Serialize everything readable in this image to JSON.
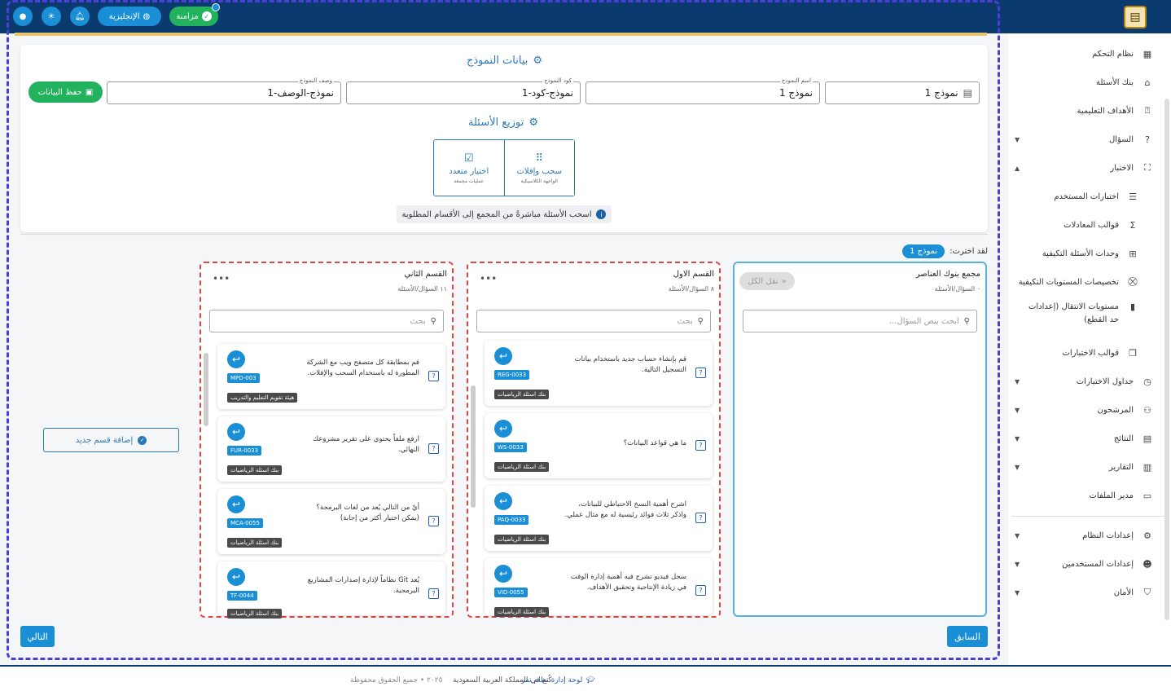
{
  "topbar": {
    "sync_label": "مزامنة",
    "language_label": "الإنجليزية",
    "colors": {
      "bar": "#0b3a6e",
      "sync": "#22b25d",
      "accent": "#1a8fd6"
    }
  },
  "sidebar": {
    "items": [
      {
        "label": "نظام التحكم",
        "icon": "dashboard-icon"
      },
      {
        "label": "بنك الأسئلة",
        "icon": "bank-icon"
      },
      {
        "label": "الأهداف التعليمية",
        "icon": "objectives-icon"
      },
      {
        "label": "السؤال",
        "icon": "question-icon"
      },
      {
        "label": "الاختبار",
        "icon": "exam-icon"
      },
      {
        "label": "اختبارات المستخدم",
        "icon": "list-icon"
      },
      {
        "label": "قوالب المعادلات",
        "icon": "sigma-icon"
      },
      {
        "label": "وحدات الأسئلة التكيفية",
        "icon": "grid-icon"
      },
      {
        "label": "تخصيصات المستويات التكيفية",
        "icon": "target-icon"
      },
      {
        "label": "مستويات الانتقال (إعدادات حد القطع)",
        "icon": "levels-icon"
      },
      {
        "label": "قوالب الاختبارات",
        "icon": "copy-icon"
      },
      {
        "label": "جداول الاختبارات",
        "icon": "clock-icon"
      },
      {
        "label": "المرشحون",
        "icon": "people-icon"
      },
      {
        "label": "النتائج",
        "icon": "chart-icon"
      },
      {
        "label": "التقارير",
        "icon": "bars-icon"
      },
      {
        "label": "مدير الملفات",
        "icon": "folder-icon"
      },
      {
        "label": "إعدادات النظام",
        "icon": "settings-icon"
      },
      {
        "label": "إعدادات المستخدمين",
        "icon": "user-settings-icon"
      },
      {
        "label": "الأمان",
        "icon": "shield-icon"
      }
    ]
  },
  "form": {
    "title": "بيانات النموذج",
    "name_label": "اسم النموذج",
    "name_value": "نموذج 1",
    "code_label": "كود النموذج",
    "code_value": "نموذج-كود-1",
    "desc_label": "وصف النموذج",
    "desc_value": "نموذج-الوصف-1",
    "extra_value": "نموذج 1",
    "save_label": "حفظ البيانات"
  },
  "distribution": {
    "title": "توزيع الأسئلة",
    "modes": [
      {
        "title": "سحب وإفلات",
        "subtitle": "الواجهة الكلاسيكية"
      },
      {
        "title": "اختيار متعدد",
        "subtitle": "عمليات مجمعة"
      }
    ],
    "info": "اسحب الأسئلة مباشرةً من المجمع إلى الأقسام المطلوبة"
  },
  "selection": {
    "label": "لقد اخترت:",
    "value": "نموذج 1"
  },
  "bank": {
    "title": "مجمع بنوك العناصر",
    "subtitle": "٠ السؤال/الأسئلة",
    "move_all": "نقل الكل",
    "search_placeholder": "ابحث بنص السؤال..."
  },
  "section1": {
    "title": "القسم الاول",
    "subtitle": "٨ السؤال/الأسئلة",
    "search_placeholder": "بحث",
    "questions": [
      {
        "text": "قم بإنشاء حساب جديد باستخدام بيانات التسجيل التالية.",
        "code": "REG-0033",
        "bank": "بنك اسئلة الرياضيات"
      },
      {
        "text": "ما هي قواعد البيانات؟",
        "code": "WS-0033",
        "bank": "بنك اسئلة الرياضيات"
      },
      {
        "text": "اشرح أهمية النسخ الاحتياطي للبيانات، واذكر ثلاث فوائد رئيسية له مع مثال عملي.",
        "code": "PAQ-0033",
        "bank": "بنك اسئلة الرياضيات"
      },
      {
        "text": "سجل فيديو تشرح فيه أهمية إدارة الوقت في زيادة الإنتاجية وتحقيق الأهداف.",
        "code": "VID-0055",
        "bank": "بنك اسئلة الرياضيات"
      }
    ]
  },
  "section2": {
    "title": "القسم الثاني",
    "subtitle": "١١ السؤال/الأسئلة",
    "search_placeholder": "بحث",
    "questions": [
      {
        "text": "قم بمطابقة كل متصفح ويب مع الشركة المطورة له باستخدام السحب والإفلات.",
        "code": "MPD-003",
        "bank": "هيئة تقويم التعليم والتدريب"
      },
      {
        "text": "ارفع ملفاً يحتوي على تقرير مشروعك النهائي.",
        "code": "FUR-0033",
        "bank": "بنك اسئلة الرياضيات"
      },
      {
        "text": "أيٌ من التالي يُعد من لغات البرمجة؟ (يمكن اختيار أكثر من إجابة)",
        "code": "MCA-0055",
        "bank": "بنك اسئلة الرياضيات"
      },
      {
        "text": "يُعد Git نظاماً لإدارة إصدارات المشاريع البرمجية.",
        "code": "TF-0044",
        "bank": "بنك اسئلة الرياضيات"
      }
    ]
  },
  "add_section_label": "إضافة قسم جديد",
  "nav": {
    "previous": "السابق",
    "next": "التالي"
  },
  "footer": {
    "brand": "لوحة إدارة نظام نمر",
    "made_in": "كُنع في المملكة العربية السعودية",
    "copyright": "٢٠٢٥ • جميع الحقوق محفوظة"
  }
}
